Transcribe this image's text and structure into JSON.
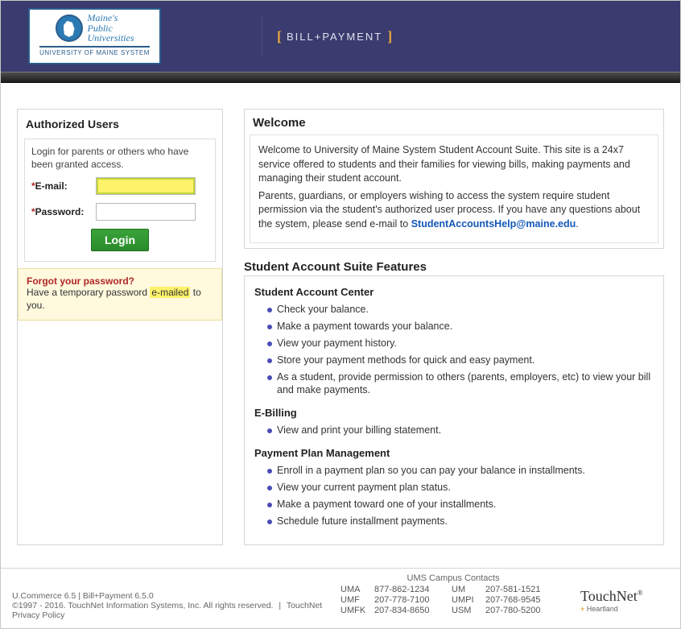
{
  "header": {
    "logo_line1": "Maine's",
    "logo_line2": "Public",
    "logo_line3": "Universities",
    "logo_sub": "UNIVERSITY OF MAINE SYSTEM",
    "bill_payment": "BILL+PAYMENT"
  },
  "login": {
    "title": "Authorized Users",
    "intro": "Login for parents or others who have been granted access.",
    "email_label": "E-mail:",
    "password_label": "Password:",
    "email_value": "",
    "password_value": "",
    "button": "Login",
    "forgot_title": "Forgot your password?",
    "forgot_text_before": "Have a temporary password ",
    "forgot_highlight": "e-mailed",
    "forgot_text_after": " to you."
  },
  "welcome": {
    "title": "Welcome",
    "p1": "Welcome to University of Maine System Student Account Suite. This site is a 24x7 service offered to students and their families for viewing bills, making payments and managing their student account.",
    "p2_before": "Parents, guardians, or employers wishing to access the system require student permission via the student's authorized user process. If you have any questions about the system, please send e-mail to ",
    "help_email": "StudentAccountsHelp@maine.edu",
    "p2_after": "."
  },
  "features": {
    "title": "Student Account Suite Features",
    "sac_title": "Student Account Center",
    "sac_items": [
      "Check your balance.",
      "Make a payment towards your balance.",
      "View your payment history.",
      "Store your payment methods for quick and easy payment.",
      "As a student, provide permission to others (parents, employers, etc) to view your bill and make payments."
    ],
    "ebill_title": "E-Billing",
    "ebill_items": [
      "View and print your billing statement."
    ],
    "ppm_title": "Payment Plan Management",
    "ppm_items": [
      "Enroll in a payment plan so you can pay your balance in installments.",
      "View your current payment plan status.",
      "Make a payment toward one of your installments.",
      "Schedule future installment payments."
    ]
  },
  "footer": {
    "line1": "U.Commerce 6.5 | Bill+Payment 6.5.0",
    "copyright": "©1997 - 2016. TouchNet Information Systems, Inc. All rights reserved.",
    "privacy": "TouchNet Privacy Policy",
    "contacts_title": "UMS Campus Contacts",
    "contacts": [
      {
        "code": "UMA",
        "phone": "877-862-1234"
      },
      {
        "code": "UM",
        "phone": "207-581-1521"
      },
      {
        "code": "UMF",
        "phone": "207-778-7100"
      },
      {
        "code": "UMPI",
        "phone": "207-768-9545"
      },
      {
        "code": "UMFK",
        "phone": "207-834-8650"
      },
      {
        "code": "USM",
        "phone": "207-780-5200"
      }
    ],
    "tn_main": "TouchNet",
    "tn_sub": "Heartland"
  }
}
